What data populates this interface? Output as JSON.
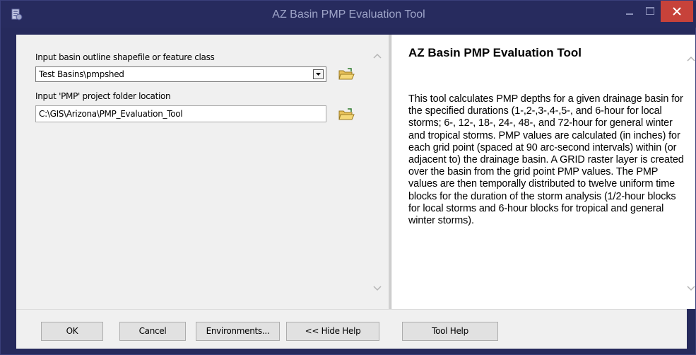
{
  "window": {
    "title": "AZ Basin PMP Evaluation Tool",
    "icon": "tool-icon"
  },
  "form": {
    "basin_label": "Input basin outline shapefile or feature class",
    "basin_value": "Test Basins\\pmpshed",
    "folder_label": "Input 'PMP' project folder location",
    "folder_value": "C:\\GIS\\Arizona\\PMP_Evaluation_Tool"
  },
  "help": {
    "title": "AZ Basin PMP Evaluation Tool",
    "body": "This tool calculates PMP depths for a given drainage basin for the specified durations (1-,2-,3-,4-,5-, and 6-hour for local storms; 6-, 12-, 18-, 24-, 48-, and 72-hour for general winter and tropical storms. PMP values are calculated (in inches) for each grid point (spaced at 90 arc-second intervals) within (or adjacent to) the drainage basin. A GRID raster layer is created over the basin from the grid point PMP values. The PMP values are then temporally distributed to twelve uniform time blocks for the duration of the storm analysis (1/2-hour blocks for local storms and 6-hour blocks for tropical and general winter storms)."
  },
  "buttons": {
    "ok": "OK",
    "cancel": "Cancel",
    "environments": "Environments...",
    "hide_help": "<< Hide Help",
    "tool_help": "Tool Help"
  },
  "colors": {
    "title_bar": "#272b5e",
    "close_button": "#c7423a",
    "panel": "#f0f0f0"
  }
}
